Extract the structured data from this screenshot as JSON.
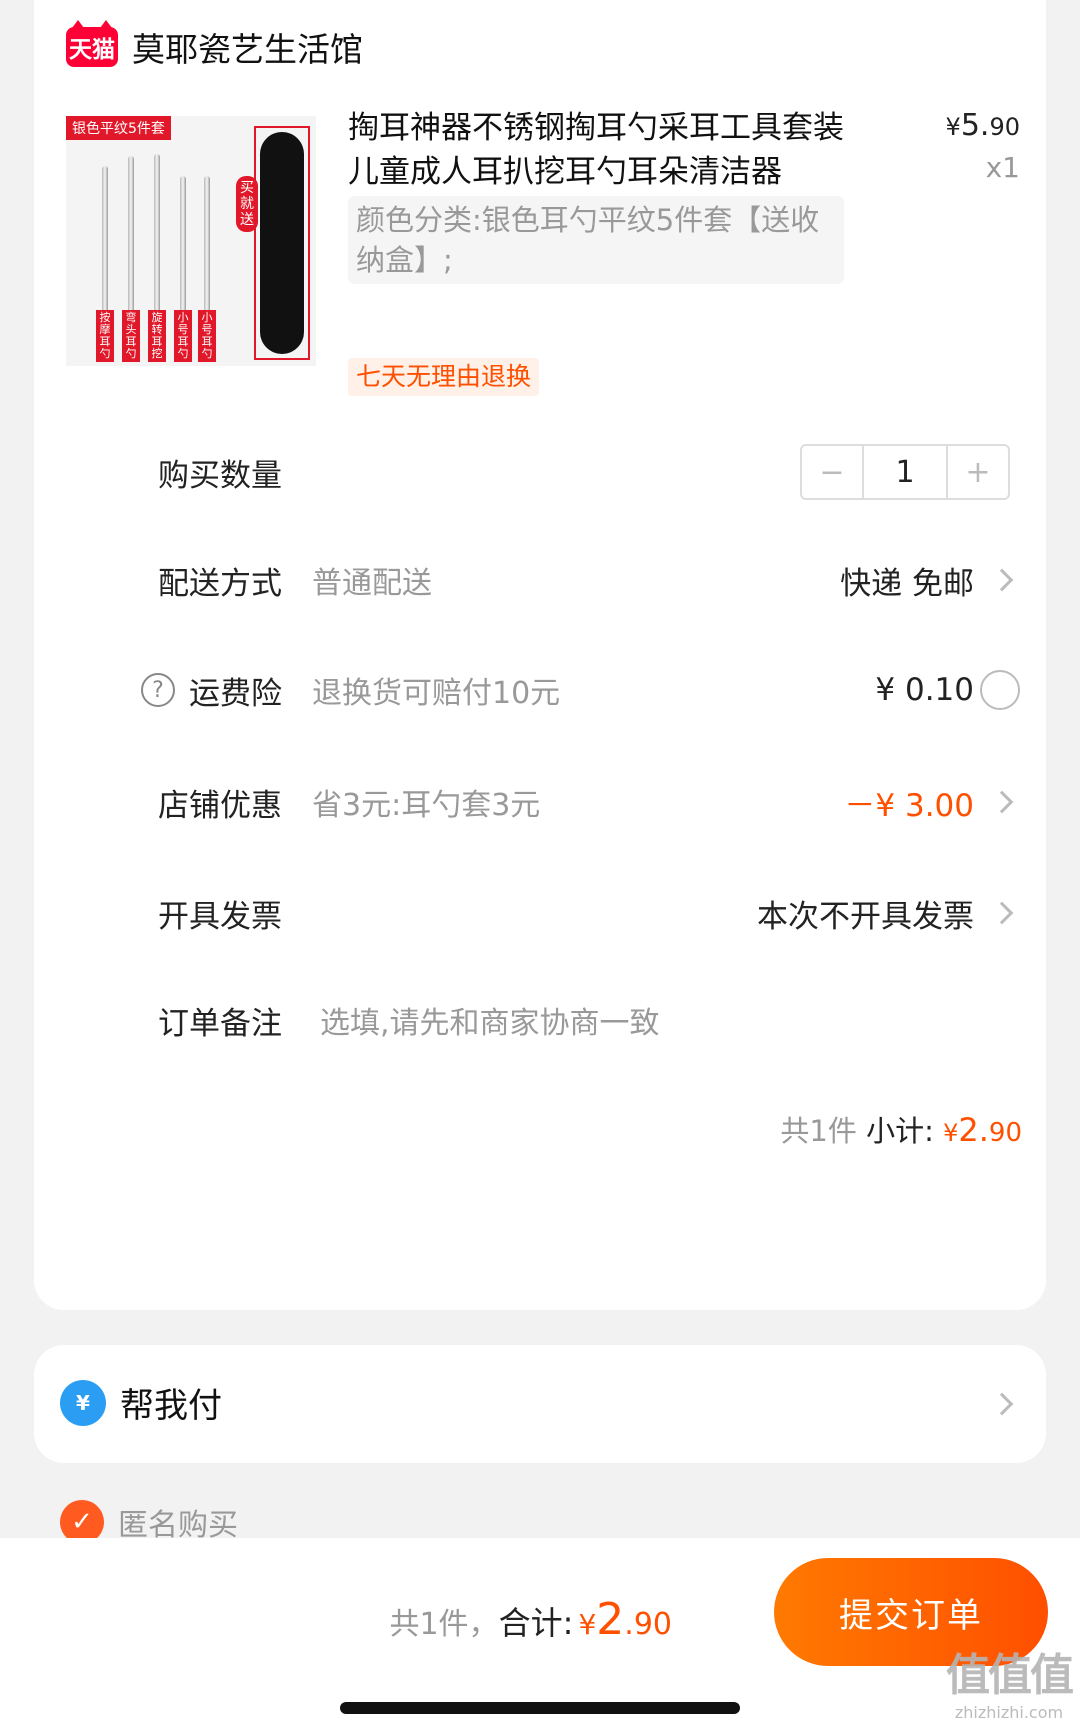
{
  "shop": {
    "badge": "天猫",
    "name": "莫耶瓷艺生活馆"
  },
  "product": {
    "image_tag": "银色平纹5件套",
    "image_gift": "买就送",
    "image_tool_labels": [
      "按摩耳勺",
      "弯头耳勺",
      "旋转耳挖",
      "小号耳勺",
      "小号耳勺"
    ],
    "title": "掏耳神器不锈钢掏耳勺采耳工具套装儿童成人耳扒挖耳勺耳朵清洁器",
    "price_symbol": "¥",
    "price_int": "5.",
    "price_dec": "90",
    "quantity": "x1",
    "sku": "颜色分类:银色耳勺平纹5件套【送收纳盒】;",
    "return_tag": "七天无理由退换"
  },
  "rows": {
    "quantity": {
      "label": "购买数量",
      "minus": "−",
      "value": "1",
      "plus": "+"
    },
    "shipping": {
      "label": "配送方式",
      "value": "普通配送",
      "right": "快递 免邮"
    },
    "insurance": {
      "help": "?",
      "label": "运费险",
      "value": "退换货可赔付10元",
      "right": "¥ 0.10"
    },
    "discount": {
      "label": "店铺优惠",
      "value": "省3元:耳勺套3元",
      "right": "－¥ 3.00"
    },
    "invoice": {
      "label": "开具发票",
      "right": "本次不开具发票"
    },
    "note": {
      "label": "订单备注",
      "placeholder": "选填,请先和商家协商一致"
    }
  },
  "subtotal": {
    "count": "共1件",
    "label": "小计:",
    "symbol": "¥",
    "int": "2.",
    "dec": "90"
  },
  "pay_for_me": {
    "icon": "¥",
    "label": "帮我付"
  },
  "anonymous": {
    "label": "匿名购买",
    "checked": true
  },
  "footer": {
    "count": "共1件，",
    "label": "合计:",
    "symbol": "¥",
    "int": "2",
    "dec": ".90",
    "submit": "提交订单"
  },
  "watermark": {
    "logo": "值值值",
    "url": "zhizhizhi.com"
  },
  "colors": {
    "accent": "#ff5000",
    "tmall": "#ff0036",
    "pay_icon": "#2b9df3"
  }
}
